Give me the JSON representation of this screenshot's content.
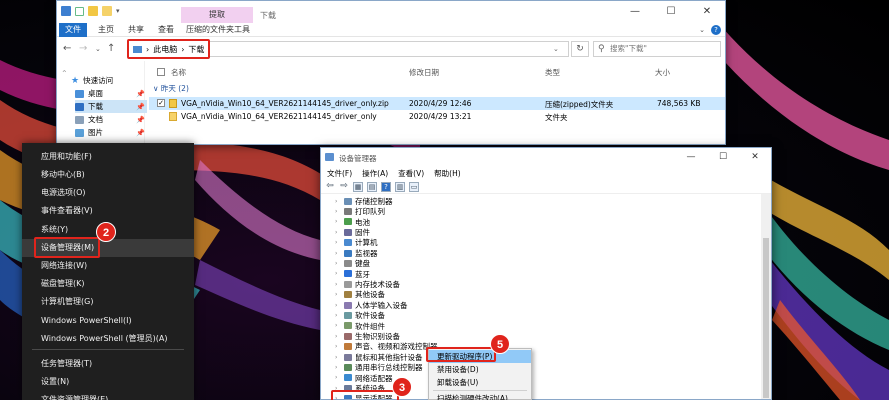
{
  "explorer": {
    "context_tab": "提取",
    "title": "下载",
    "ribbon_tabs": [
      "文件",
      "主页",
      "共享",
      "查看",
      "压缩的文件夹工具"
    ],
    "address": {
      "root": "此电脑",
      "folder": "下载",
      "separator": "›"
    },
    "search_placeholder": "搜索\"下载\"",
    "nav_items": [
      {
        "label": "快速访问",
        "color": "#3d8ee0"
      },
      {
        "label": "桌面",
        "color": "#4a90d9"
      },
      {
        "label": "下载",
        "color": "#2f6fc2"
      },
      {
        "label": "文档",
        "color": "#8aa0b8"
      },
      {
        "label": "图片",
        "color": "#5aa0d8"
      }
    ],
    "columns": {
      "name": "名称",
      "modified": "修改日期",
      "type": "类型",
      "size": "大小"
    },
    "group": "昨天 (2)",
    "files": [
      {
        "name": "VGA_nVidia_Win10_64_VER2621144145_driver_only.zip",
        "modified": "2020/4/29 12:46",
        "type": "压缩(zipped)文件夹",
        "size": "748,563 KB"
      },
      {
        "name": "VGA_nVidia_Win10_64_VER2621144145_driver_only",
        "modified": "2020/4/29 13:21",
        "type": "文件夹",
        "size": ""
      }
    ]
  },
  "winx_menu": {
    "items": [
      "应用和功能(F)",
      "移动中心(B)",
      "电源选项(O)",
      "事件查看器(V)",
      "系统(Y)",
      "设备管理器(M)",
      "网络连接(W)",
      "磁盘管理(K)",
      "计算机管理(G)",
      "Windows PowerShell(I)",
      "Windows PowerShell (管理员)(A)",
      "任务管理器(T)",
      "设置(N)",
      "文件资源管理器(E)"
    ],
    "highlight_index": 5
  },
  "devmgr": {
    "title": "设备管理器",
    "menus": [
      "文件(F)",
      "操作(A)",
      "查看(V)",
      "帮助(H)"
    ],
    "tree": [
      {
        "label": "存储控制器",
        "color": "#6a8fb5"
      },
      {
        "label": "打印队列",
        "color": "#7a7a7a"
      },
      {
        "label": "电池",
        "color": "#4c9e4c"
      },
      {
        "label": "固件",
        "color": "#6a6a9a"
      },
      {
        "label": "计算机",
        "color": "#4a8ad0"
      },
      {
        "label": "监视器",
        "color": "#3a7ac0"
      },
      {
        "label": "键盘",
        "color": "#8a8a8a"
      },
      {
        "label": "蓝牙",
        "color": "#2a6fd8"
      },
      {
        "label": "内存技术设备",
        "color": "#9a9a9a"
      },
      {
        "label": "其他设备",
        "color": "#a08040"
      },
      {
        "label": "人体学输入设备",
        "color": "#8a7ab0"
      },
      {
        "label": "软件设备",
        "color": "#6a9aa0"
      },
      {
        "label": "软件组件",
        "color": "#7a9a6a"
      },
      {
        "label": "生物识别设备",
        "color": "#9a6a6a"
      },
      {
        "label": "声音、视频和游戏控制器",
        "color": "#c07a3a"
      },
      {
        "label": "鼠标和其他指针设备",
        "color": "#7a7a9a"
      },
      {
        "label": "通用串行总线控制器",
        "color": "#5a8a5a"
      },
      {
        "label": "网络适配器",
        "color": "#3a8ad0"
      },
      {
        "label": "系统设备",
        "color": "#6a7a9a"
      },
      {
        "label": "显示适配器",
        "color": "#3a7ac0"
      }
    ]
  },
  "context_menu": {
    "items": [
      "更新驱动程序(P)",
      "禁用设备(D)",
      "卸载设备(U)",
      "扫描检测硬件改动(A)"
    ],
    "highlight_index": 0
  },
  "badges": [
    "2",
    "3",
    "5"
  ],
  "colors": {
    "accent": "#1e6fc8",
    "callout": "#e0241c"
  }
}
